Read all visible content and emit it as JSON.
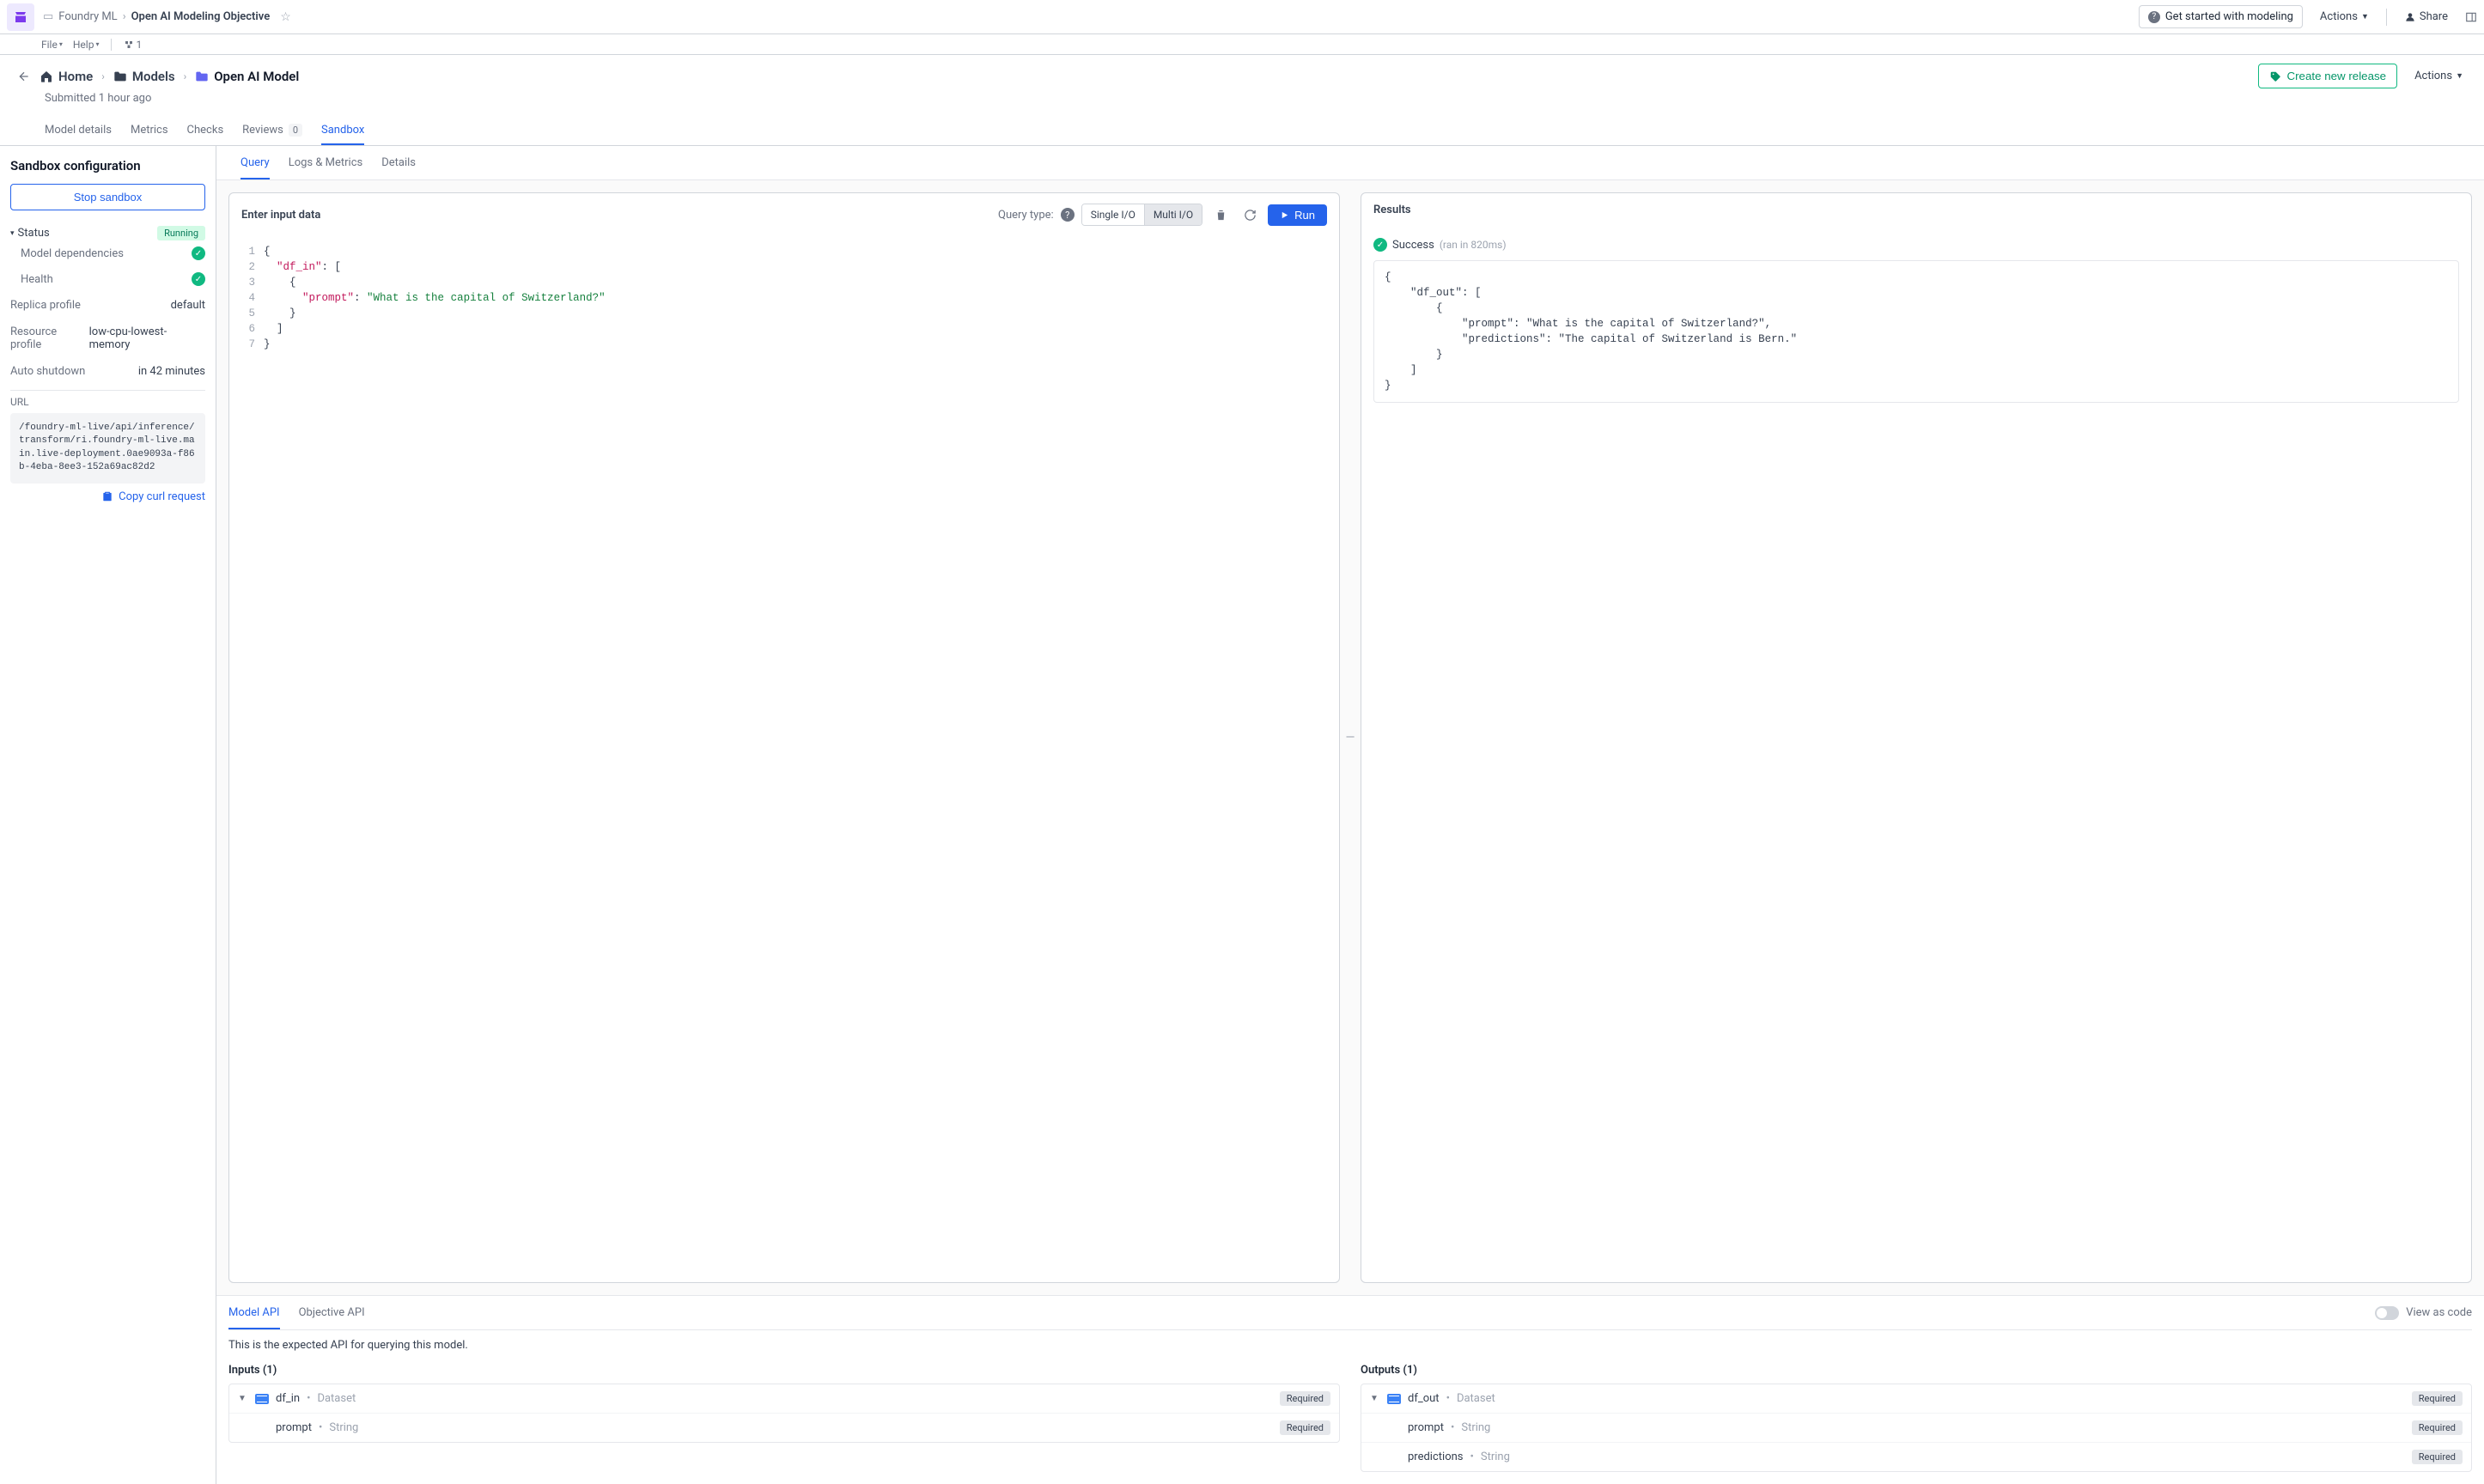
{
  "topbar": {
    "project": "Foundry ML",
    "title": "Open AI Modeling Objective",
    "menu": {
      "file": "File",
      "help": "Help",
      "users": "1"
    },
    "get_started": "Get started with modeling",
    "actions": "Actions",
    "share": "Share"
  },
  "breadcrumb": {
    "home": "Home",
    "models": "Models",
    "current": "Open AI Model",
    "submitted": "Submitted 1 hour ago",
    "create_release": "Create new release",
    "actions": "Actions"
  },
  "tabs": {
    "items": [
      "Model details",
      "Metrics",
      "Checks",
      "Reviews",
      "Sandbox"
    ],
    "reviews_count": "0"
  },
  "sidebar": {
    "title": "Sandbox configuration",
    "stop": "Stop sandbox",
    "status_label": "Status",
    "status_value": "Running",
    "deps": "Model dependencies",
    "health": "Health",
    "replica_k": "Replica profile",
    "replica_v": "default",
    "resource_k": "Resource profile",
    "resource_v": "low-cpu-lowest-memory",
    "shutdown_k": "Auto shutdown",
    "shutdown_v": "in 42 minutes",
    "url_label": "URL",
    "url": "/foundry-ml-live/api/inference/transform/ri.foundry-ml-live.main.live-deployment.0ae9093a-f86b-4eba-8ee3-152a69ac82d2",
    "copy": "Copy curl request"
  },
  "subtabs": {
    "query": "Query",
    "logs": "Logs & Metrics",
    "details": "Details"
  },
  "input_panel": {
    "title": "Enter input data",
    "qtype_label": "Query type:",
    "single": "Single I/O",
    "multi": "Multi I/O",
    "run": "Run",
    "code": {
      "l1": "{",
      "l2a": "\"df_in\"",
      "l2b": ": [",
      "l3": "{",
      "l4a": "\"prompt\"",
      "l4b": ": ",
      "l4c": "\"What is the capital of Switzerland?\"",
      "l5": "}",
      "l6": "]",
      "l7": "}"
    }
  },
  "results_panel": {
    "title": "Results",
    "success": "Success",
    "ran": "(ran in 820ms)",
    "body": "{\n    \"df_out\": [\n        {\n            \"prompt\": \"What is the capital of Switzerland?\",\n            \"predictions\": \"The capital of Switzerland is Bern.\"\n        }\n    ]\n}"
  },
  "api": {
    "model_tab": "Model API",
    "obj_tab": "Objective API",
    "view_as_code": "View as code",
    "desc": "This is the expected API for querying this model.",
    "inputs_title": "Inputs (1)",
    "outputs_title": "Outputs (1)",
    "inputs": {
      "root_name": "df_in",
      "root_type": "Dataset",
      "field1": "prompt",
      "field1_type": "String"
    },
    "outputs": {
      "root_name": "df_out",
      "root_type": "Dataset",
      "field1": "prompt",
      "field1_type": "String",
      "field2": "predictions",
      "field2_type": "String"
    },
    "required": "Required"
  }
}
